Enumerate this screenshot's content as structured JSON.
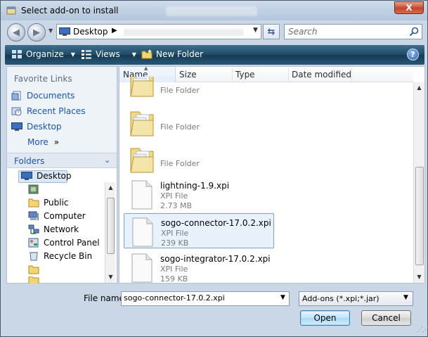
{
  "window": {
    "title": "Select add-on to install",
    "close_label": "X"
  },
  "address": {
    "location": "Desktop",
    "search_placeholder": "Search"
  },
  "toolbar": {
    "organize": "Organize",
    "views": "Views",
    "new_folder": "New Folder",
    "help": "?"
  },
  "left_pane": {
    "favorite_links_title": "Favorite Links",
    "favorites": [
      {
        "label": "Documents",
        "icon": "documents-icon"
      },
      {
        "label": "Recent Places",
        "icon": "recent-places-icon"
      },
      {
        "label": "Desktop",
        "icon": "desktop-icon"
      }
    ],
    "more_label": "More",
    "more_arrows": "»",
    "folders_title": "Folders",
    "tree": [
      {
        "label": "Desktop",
        "icon": "desktop-icon",
        "selected": true
      },
      {
        "label": "",
        "icon": "user-folder-icon"
      },
      {
        "label": "Public",
        "icon": "folder-icon"
      },
      {
        "label": "Computer",
        "icon": "computer-icon"
      },
      {
        "label": "Network",
        "icon": "network-icon"
      },
      {
        "label": "Control Panel",
        "icon": "control-panel-icon"
      },
      {
        "label": "Recycle Bin",
        "icon": "recycle-bin-icon"
      },
      {
        "label": "",
        "icon": "folder-icon"
      },
      {
        "label": "",
        "icon": "folder-icon"
      }
    ]
  },
  "columns": [
    "Name",
    "Size",
    "Type",
    "Date modified"
  ],
  "files": [
    {
      "name": "",
      "type": "File Folder",
      "size": "",
      "kind": "folder"
    },
    {
      "name": "",
      "type": "File Folder",
      "size": "",
      "kind": "folder"
    },
    {
      "name": "",
      "type": "File Folder",
      "size": "",
      "kind": "folder"
    },
    {
      "name": "lightning-1.9.xpi",
      "type": "XPI File",
      "size": "2.73 MB",
      "kind": "file"
    },
    {
      "name": "sogo-connector-17.0.2.xpi",
      "type": "XPI File",
      "size": "239 KB",
      "kind": "file",
      "selected": true
    },
    {
      "name": "sogo-integrator-17.0.2.xpi",
      "type": "XPI File",
      "size": "159 KB",
      "kind": "file"
    }
  ],
  "bottom": {
    "file_name_label": "File name:",
    "file_name_value": "sogo-connector-17.0.2.xpi",
    "filter": "Add-ons (*.xpi;*.jar)",
    "open": "Open",
    "cancel": "Cancel"
  },
  "colors": {
    "toolbar": "#1f4a66",
    "link": "#1a55b5",
    "selection": "#e8f2fc"
  }
}
